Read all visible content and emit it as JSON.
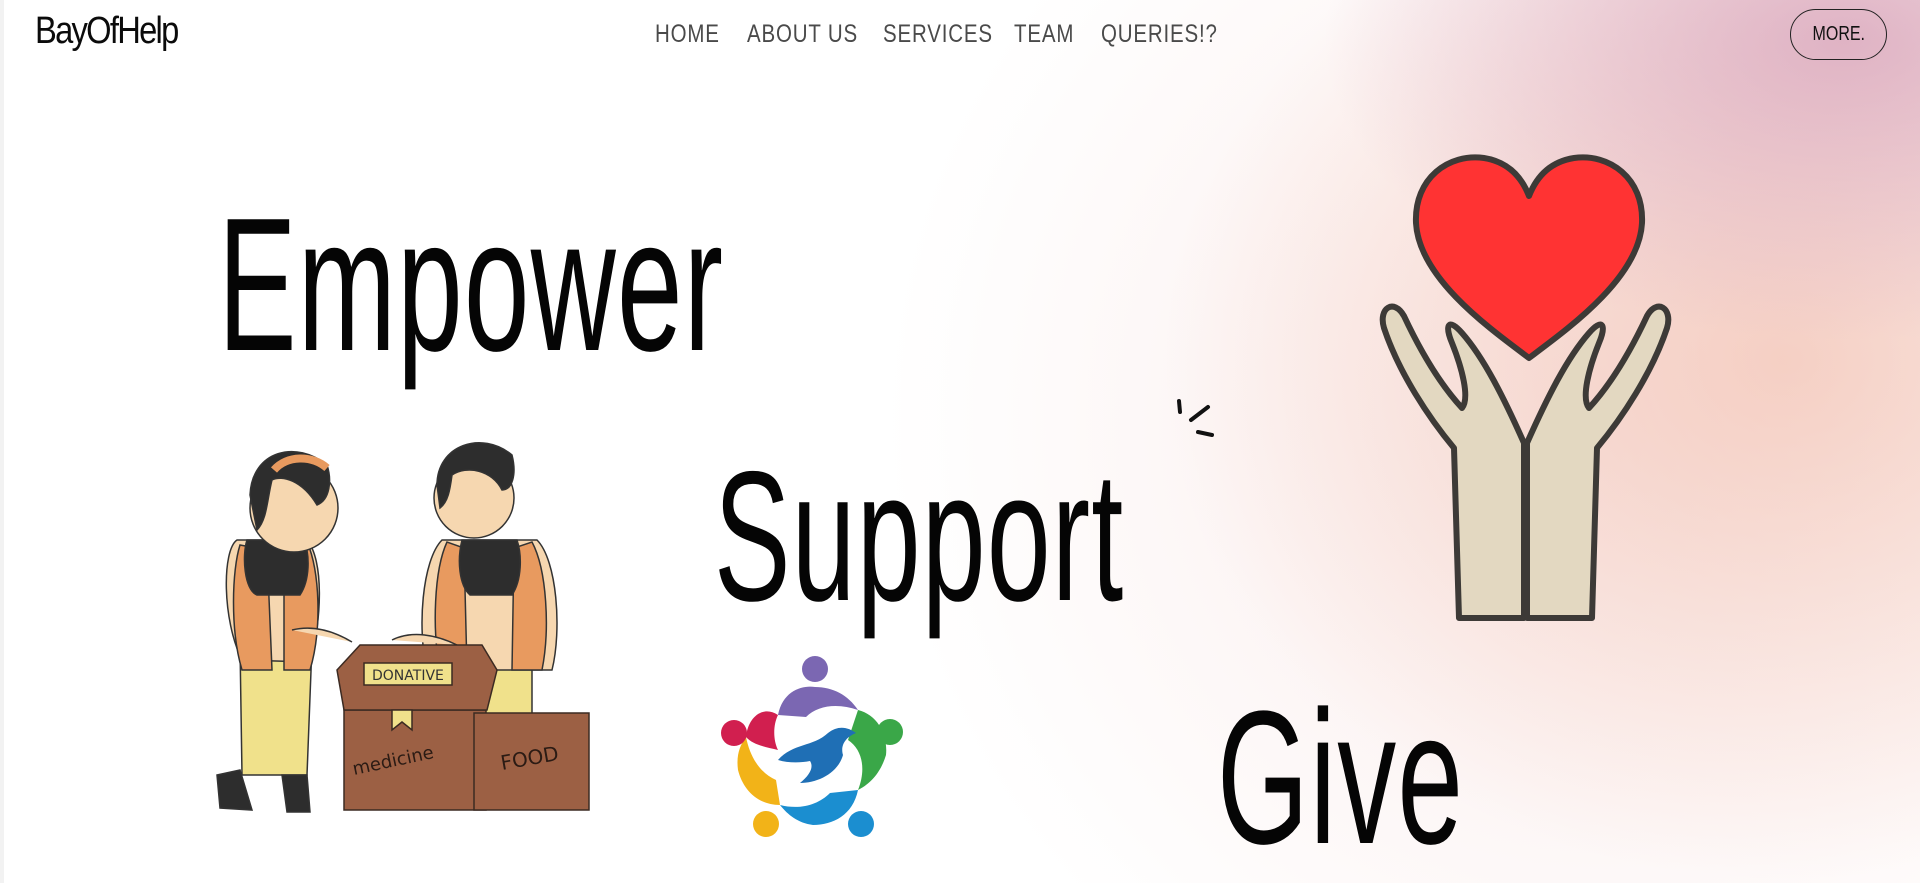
{
  "header": {
    "brand": "BayOfHelp",
    "nav": [
      "HOME",
      "ABOUT US",
      "SERVICES",
      "TEAM",
      "QUERIES!?"
    ],
    "more_label": "MORE."
  },
  "hero": {
    "words": [
      "Empower",
      "Support",
      "Give"
    ],
    "box_labels": {
      "tag": "DONATIVE",
      "left_box": "medicine",
      "right_box": "FOOD"
    }
  },
  "icons": {
    "hands": "heart-in-hands-icon",
    "volunteers": "volunteers-donation-icon",
    "community": "community-dove-logo-icon",
    "spark": "sparkle-lines-icon"
  },
  "colors": {
    "heart": "#ff3333",
    "hands": "#e3d8c1",
    "outline": "#3d3a37",
    "box": "#9c6044",
    "vest": "#e89a5f",
    "pants": "#f0e18b"
  }
}
